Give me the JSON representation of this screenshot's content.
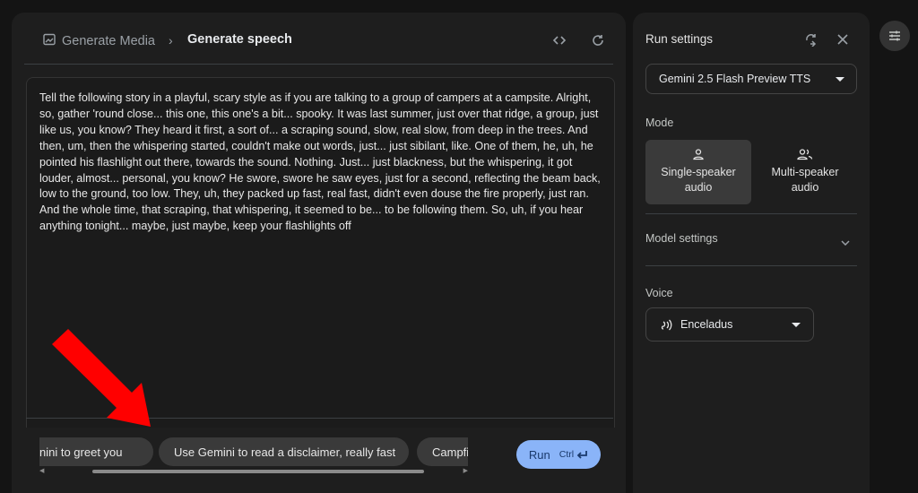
{
  "header": {
    "parent_label": "Generate Media",
    "title": "Generate speech"
  },
  "prompt": {
    "text": "Tell the following story in a playful, scary style as if you are talking to a group of campers at a campsite. Alright, so, gather 'round close... this one, this one's a bit... spooky. It was last summer, just over that ridge, a group, just like us, you know? They heard it first, a sort of... a scraping sound, slow, real slow, from deep in the trees. And then, um, then the whispering started, couldn't make out words, just... just sibilant, like. One of them, he, uh, he pointed his flashlight out there, towards the sound. Nothing. Just... just blackness, but the whispering, it got louder, almost... personal, you know? He swore, swore he saw eyes, just for a second, reflecting the beam back, low to the ground, too low. They, uh, they packed up fast, real fast, didn't even douse the fire properly, just ran. And the whole time, that scraping, that whispering, it seemed to be... to be following them. So, uh, if you hear anything tonight... maybe, just maybe, keep your flashlights off"
  },
  "suggestions": [
    "nini to greet you",
    "Use Gemini to read a disclaimer, really fast",
    "Campfire"
  ],
  "run": {
    "label": "Run",
    "shortcut": "Ctrl"
  },
  "settings": {
    "title": "Run settings",
    "model": "Gemini 2.5 Flash Preview TTS",
    "mode_label": "Mode",
    "modes": [
      {
        "line1": "Single-speaker",
        "line2": "audio",
        "selected": true
      },
      {
        "line1": "Multi-speaker",
        "line2": "audio",
        "selected": false
      }
    ],
    "model_settings_label": "Model settings",
    "voice_label": "Voice",
    "voice": "Enceladus"
  },
  "colors": {
    "accent": "#8ab4f8",
    "annotation_arrow": "#ff0000",
    "background": "#141414",
    "panel": "#1e1e1e"
  },
  "icons": [
    "image-icon",
    "chevron-right-icon",
    "code-icon",
    "refresh-icon",
    "compare-icon",
    "close-icon",
    "enter-key-icon",
    "person-icon",
    "people-icon",
    "chevron-down-icon",
    "voice-icon",
    "tune-icon"
  ]
}
